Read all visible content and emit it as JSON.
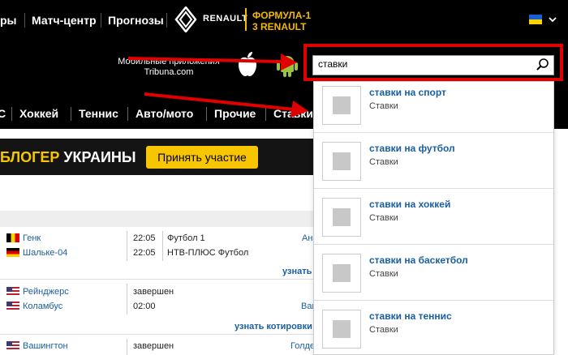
{
  "topnav": {
    "items": [
      "ры",
      "Матч-центр",
      "Прогнозы"
    ],
    "sponsor_text": "RENAULT",
    "f1_line1": "ФОРМУЛА-1",
    "f1_line2": "3 RENAULT"
  },
  "mobile": {
    "line1": "Мобильные приложения",
    "line2": "Tribuna.com"
  },
  "search": {
    "value": "ставки"
  },
  "sports_nav": {
    "items": [
      "С",
      "Хоккей",
      "Теннис",
      "Авто/мото",
      "Прочие",
      "Ставки"
    ]
  },
  "banner": {
    "title_yellow": "БЛОГЕР",
    "title_white": " УКРАИНЫ",
    "button": "Принять участие"
  },
  "matches": [
    {
      "team1": "Генк",
      "team2": "Шальке-04",
      "time1": "22:05",
      "time2": "22:05",
      "channel1": "Футбол 1",
      "channel2": "НТВ-ПЛЮС Футбол",
      "right": "Ан"
    },
    {
      "team1": "Рейнджерс",
      "team2": "Коламбус",
      "time1": "завершен",
      "time2": "02:00",
      "right": "Ваг"
    },
    {
      "team1": "Вашингтон",
      "time1": "завершен",
      "right": "Голде"
    }
  ],
  "odds_link": "узнать котировки",
  "odds_link_short": "узнать",
  "dropdown": [
    {
      "title": "ставки на спорт",
      "sub": "Ставки"
    },
    {
      "title": "ставки на футбол",
      "sub": "Ставки"
    },
    {
      "title": "ставки на хоккей",
      "sub": "Ставки"
    },
    {
      "title": "ставки на баскетбол",
      "sub": "Ставки"
    },
    {
      "title": "ставки на теннис",
      "sub": "Ставки"
    }
  ],
  "colors": {
    "highlight": "#e00000",
    "accent_yellow": "#f7c600",
    "link_blue": "#1a5fa0"
  }
}
